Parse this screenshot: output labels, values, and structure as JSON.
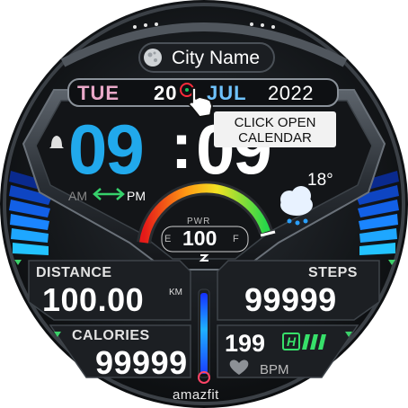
{
  "watch_face": {
    "city": "City Name",
    "date": {
      "day": "TUE",
      "date": "20",
      "month": "JUL",
      "year": "2022"
    },
    "time": {
      "hours": "09",
      "separator": ":",
      "minutes": "09"
    },
    "tooltip": {
      "line1": "CLICK OPEN",
      "line2": "CALENDAR"
    },
    "am_label": "AM",
    "pm_label": "PM",
    "temperature": "18°",
    "weather_icon": "cloud-rain-icon",
    "power": {
      "label": "PWR",
      "value": "100",
      "empty_label": "E",
      "full_label": "F",
      "level_percent": 100
    },
    "distance": {
      "label": "DISTANCE",
      "value": "100.00",
      "unit": "KM"
    },
    "steps": {
      "label": "STEPS",
      "value": "99999"
    },
    "calories": {
      "label": "CALORIES",
      "value": "99999"
    },
    "heart_rate": {
      "value": "199",
      "zone_badge": "H",
      "unit": "BPM"
    },
    "brand": "amazfit"
  },
  "colors": {
    "hours": "#21a9ec",
    "day": "#e9a8c8",
    "month": "#6fc3ff",
    "accent_green": "#37e06a",
    "accent_blue": "#1a7bff"
  }
}
